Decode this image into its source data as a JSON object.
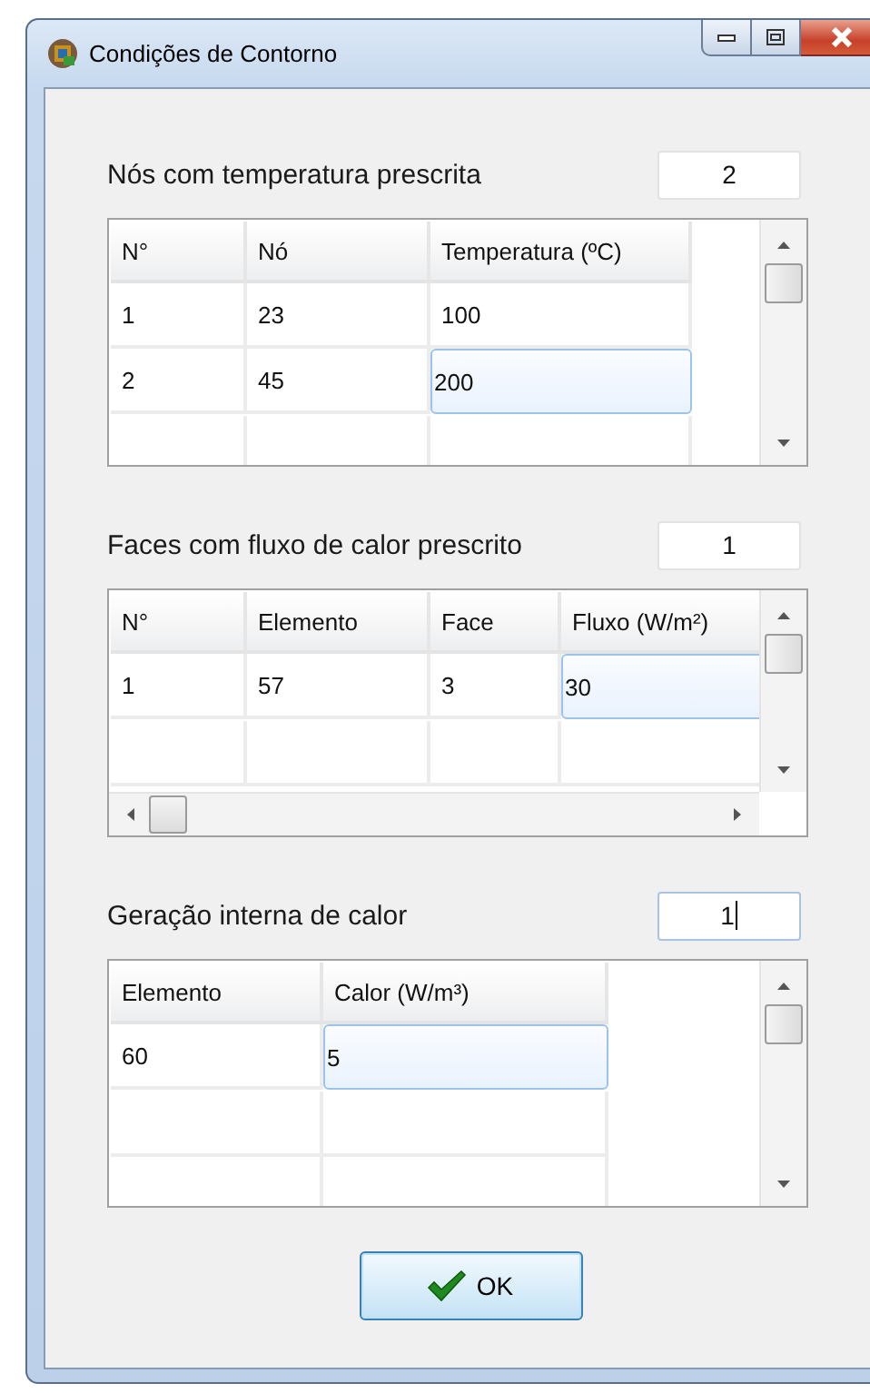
{
  "window": {
    "title": "Condições de Contorno"
  },
  "sections": [
    {
      "label": "Nós com temperatura prescrita",
      "count": {
        "value": "2",
        "focused": false
      },
      "table": {
        "horizontal_scrollbar": false,
        "columns": [
          "N°",
          "Nó",
          "Temperatura (ºC)"
        ],
        "rows": [
          {
            "cells": [
              {
                "text": "1",
                "selected": false
              },
              {
                "text": "23",
                "selected": false
              },
              {
                "text": "100",
                "selected": false
              }
            ]
          },
          {
            "cells": [
              {
                "text": "2",
                "selected": false
              },
              {
                "text": "45",
                "selected": false
              },
              {
                "text": "200",
                "selected": true
              }
            ]
          }
        ]
      }
    },
    {
      "label": "Faces com fluxo de calor prescrito",
      "count": {
        "value": "1",
        "focused": false
      },
      "table": {
        "horizontal_scrollbar": true,
        "columns": [
          "N°",
          "Elemento",
          "Face",
          "Fluxo (W/m²)"
        ],
        "rows": [
          {
            "cells": [
              {
                "text": "1",
                "selected": false
              },
              {
                "text": "57",
                "selected": false
              },
              {
                "text": "3",
                "selected": false
              },
              {
                "text": "30",
                "selected": true
              }
            ]
          }
        ]
      }
    },
    {
      "label": "Geração interna de calor",
      "count": {
        "value": "1",
        "focused": true
      },
      "table": {
        "horizontal_scrollbar": false,
        "columns": [
          "Elemento",
          "Calor (W/m³)"
        ],
        "rows": [
          {
            "cells": [
              {
                "text": "60",
                "selected": false
              },
              {
                "text": "5",
                "selected": true
              }
            ]
          }
        ]
      }
    }
  ],
  "buttons": [
    {
      "label": "OK"
    }
  ]
}
